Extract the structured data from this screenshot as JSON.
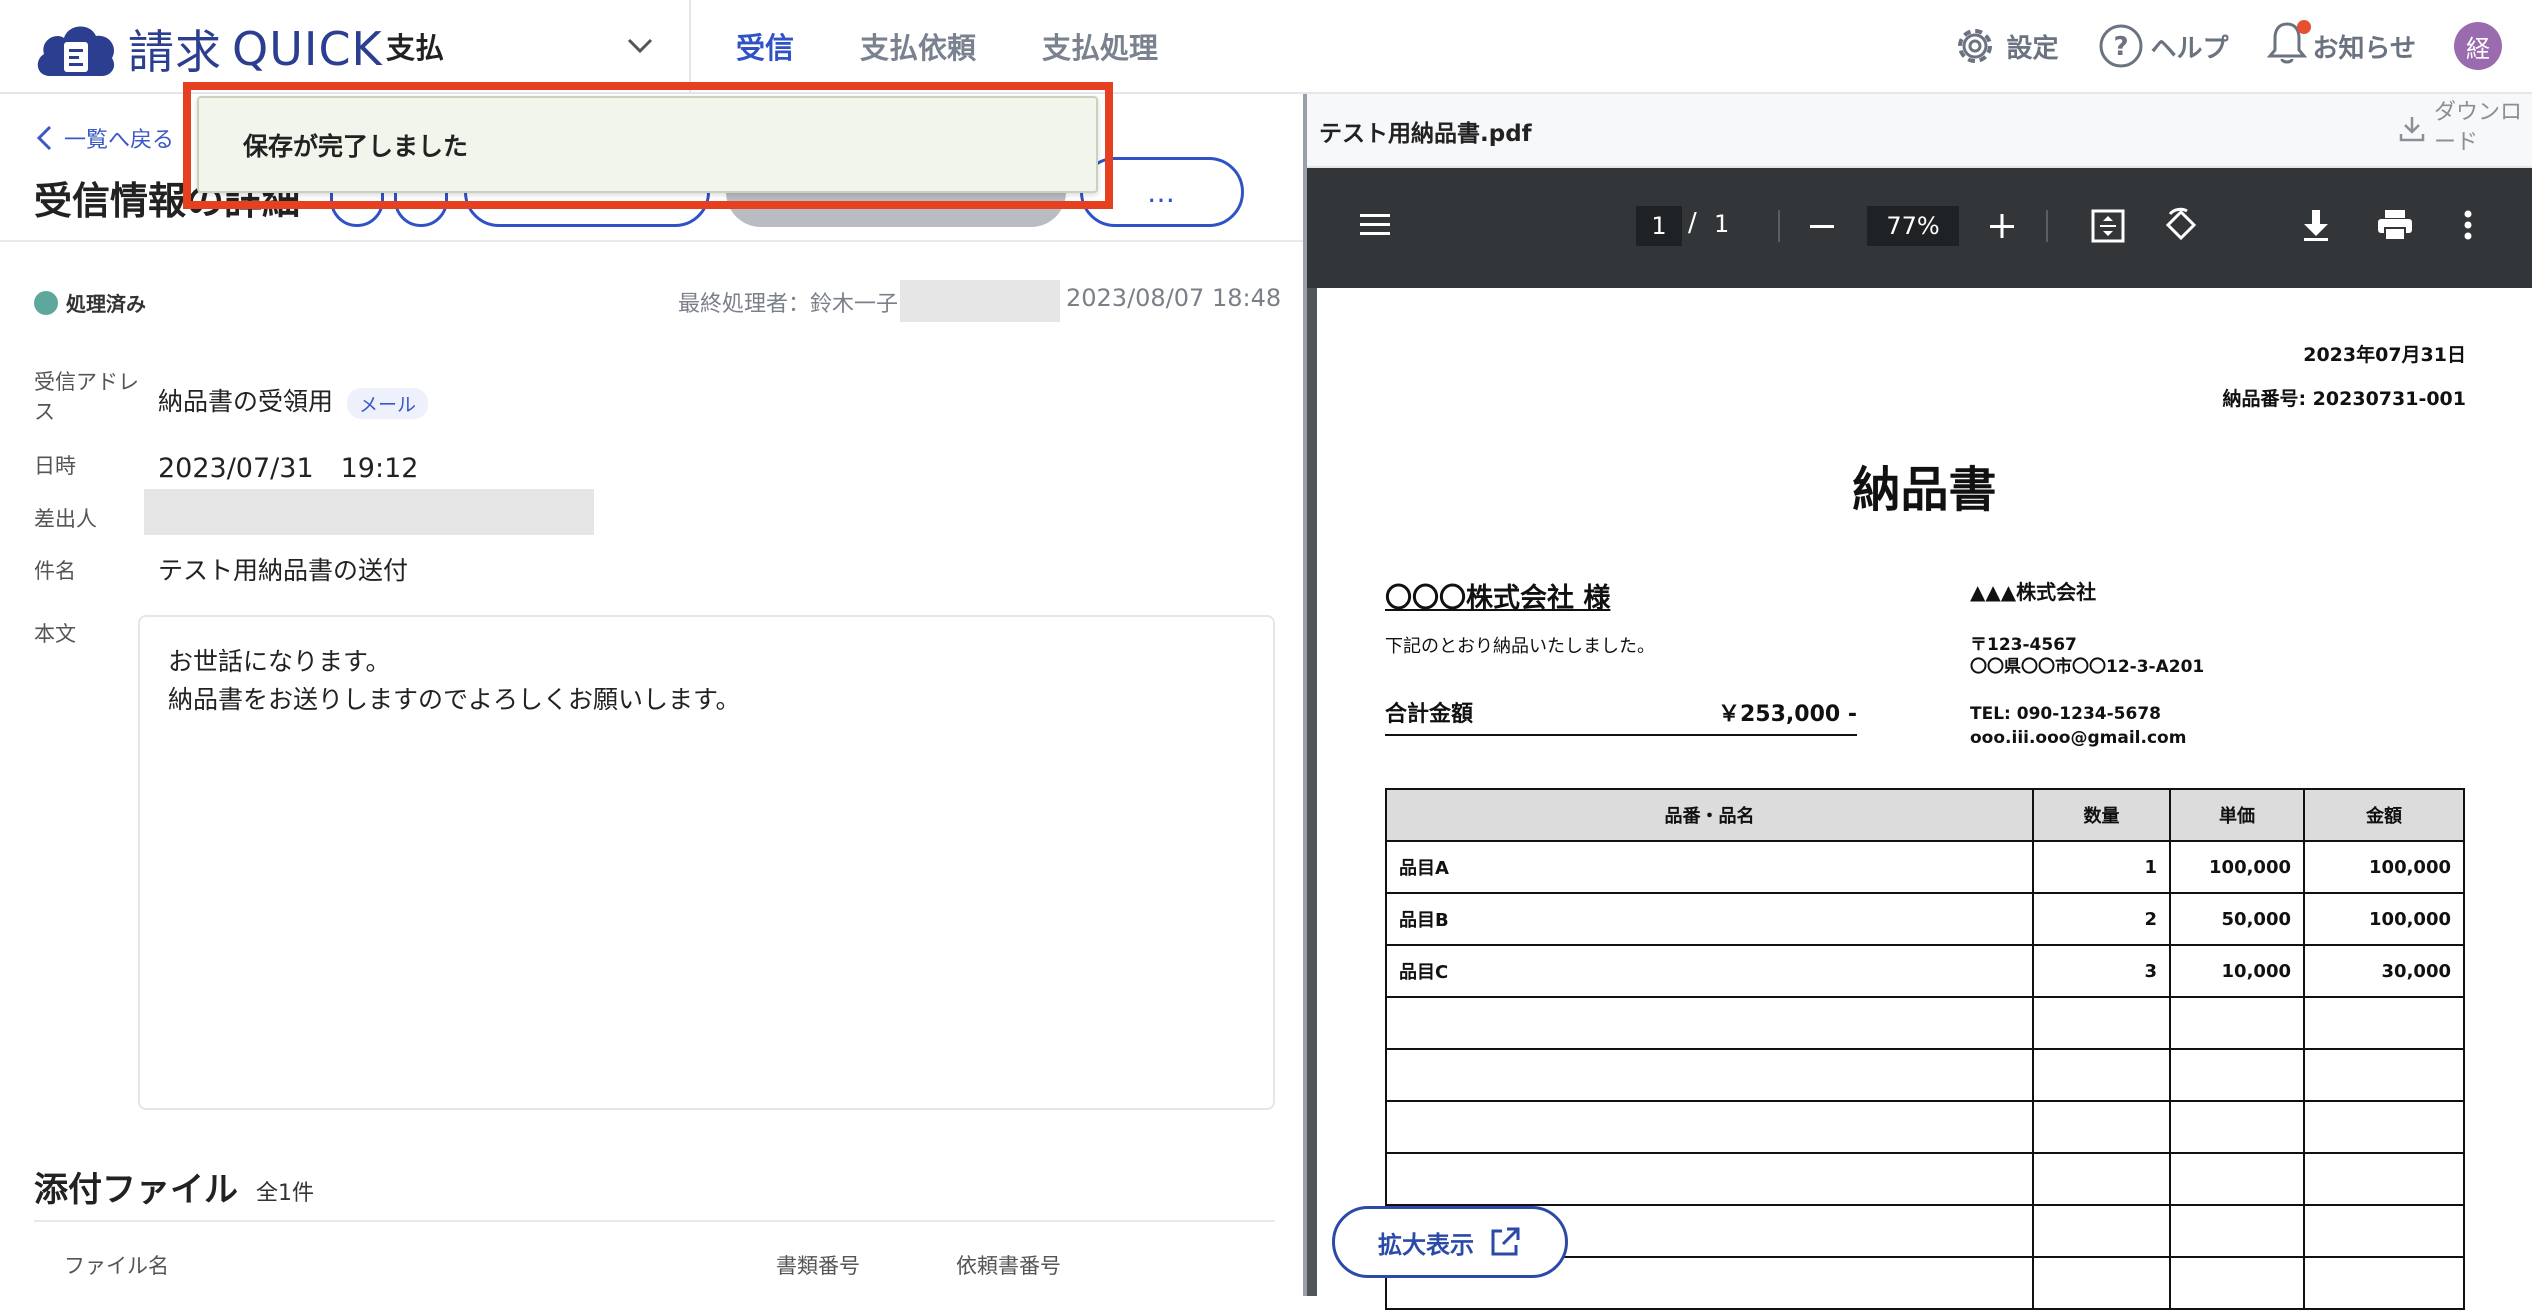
{
  "app": {
    "logo_kanji": "請求",
    "logo_latin": "QUICK",
    "module": "支払",
    "nav": [
      "受信",
      "支払依頼",
      "支払処理"
    ],
    "active_nav": "受信",
    "settings": "設定",
    "help": "ヘルプ",
    "notifications": "お知らせ",
    "avatar": "経"
  },
  "left": {
    "back": "一覧へ戻る",
    "title": "受信情報の詳細",
    "more": "…",
    "status": "処理済み",
    "last_processor": "最終処理者：鈴木一子",
    "last_date": "2023/08/07 18:48",
    "fields": {
      "address_label_1": "受信アドレ",
      "address_label_2": "ス",
      "address_value": "納品書の受領用",
      "address_tag": "メール",
      "date_label": "日時",
      "date_value": "2023/07/31　19:12",
      "sender_label": "差出人",
      "subject_label": "件名",
      "subject_value": "テスト用納品書の送付",
      "body_label": "本文",
      "body_line1": "お世話になります。",
      "body_line2": "納品書をお送りしますのでよろしくお願いします。"
    },
    "attachments": {
      "title": "添付ファイル",
      "count": "全1件",
      "col_filename": "ファイル名",
      "col_doc_no": "書類番号",
      "col_request_no": "依頼書番号"
    }
  },
  "toast": {
    "message": "保存が完了しました"
  },
  "pdf": {
    "filename": "テスト用納品書.pdf",
    "download_1": "ダウンロ",
    "download_2": "ード",
    "page_current": "1",
    "page_sep": "/",
    "page_total": "1",
    "zoom": "77%",
    "expand": "拡大表示",
    "doc": {
      "date": "2023年07月31日",
      "number": "納品番号: 20230731-001",
      "title": "納品書",
      "to": "〇〇〇株式会社 様",
      "intro": "下記のとおり納品いたしました。",
      "total_label": "合計金額",
      "total_value": "￥253,000 -",
      "seller": "▲▲▲株式会社",
      "postal": "〒123-4567",
      "address": "〇〇県〇〇市〇〇12-3-A201",
      "tel": "TEL: 090-1234-5678",
      "email": "ooo.iii.ooo@gmail.com",
      "headers": [
        "品番・品名",
        "数量",
        "単価",
        "金額"
      ],
      "rows": [
        [
          "品目A",
          "1",
          "100,000",
          "100,000"
        ],
        [
          "品目B",
          "2",
          "50,000",
          "100,000"
        ],
        [
          "品目C",
          "3",
          "10,000",
          "30,000"
        ]
      ],
      "empty_rows": 6
    }
  }
}
